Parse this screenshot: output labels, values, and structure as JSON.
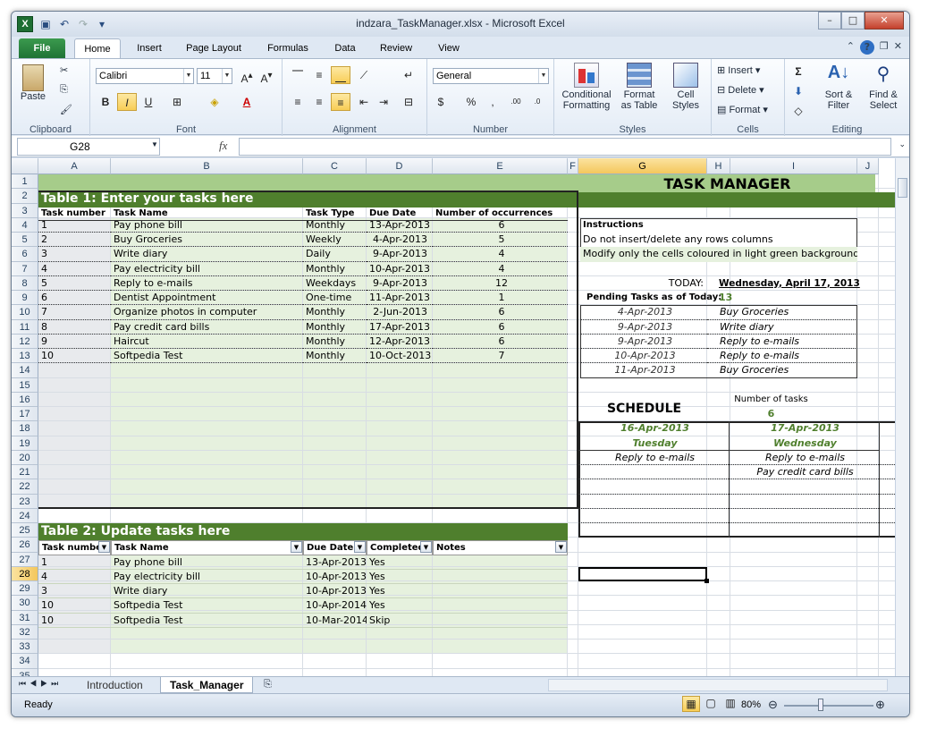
{
  "window": {
    "title": "indzara_TaskManager.xlsx - Microsoft Excel",
    "app_icon": "X"
  },
  "tabs": [
    {
      "label": "File"
    },
    {
      "label": "Home"
    },
    {
      "label": "Insert"
    },
    {
      "label": "Page Layout"
    },
    {
      "label": "Formulas"
    },
    {
      "label": "Data"
    },
    {
      "label": "Review"
    },
    {
      "label": "View"
    }
  ],
  "ribbon": {
    "clipboard": {
      "name": "Clipboard",
      "paste": "Paste"
    },
    "font": {
      "name": "Font",
      "family": "Calibri",
      "size": "11"
    },
    "alignment": {
      "name": "Alignment"
    },
    "number": {
      "name": "Number",
      "format": "General"
    },
    "styles": {
      "name": "Styles",
      "conditional": "Conditional",
      "conditional2": "Formatting",
      "format_table": "Format",
      "format_table2": "as Table",
      "cell_styles": "Cell",
      "cell_styles2": "Styles"
    },
    "cells": {
      "name": "Cells",
      "insert": "Insert",
      "delete": "Delete",
      "format": "Format"
    },
    "editing": {
      "name": "Editing",
      "sort": "Sort &",
      "sort2": "Filter",
      "find": "Find &",
      "find2": "Select"
    }
  },
  "formula_bar": {
    "name_box": "G28",
    "fx": "fx",
    "value": ""
  },
  "columns": [
    "A",
    "B",
    "C",
    "D",
    "E",
    "F",
    "G",
    "H",
    "I",
    "J"
  ],
  "sheet": {
    "title": "TASK MANAGER",
    "table1": {
      "header": "Table 1: Enter your tasks here",
      "columns": [
        "Task number",
        "Task Name",
        "Task Type",
        "Due Date",
        "Number of occurrences"
      ],
      "rows": [
        [
          "1",
          "Pay phone bill",
          "Monthly",
          "13-Apr-2013",
          "6"
        ],
        [
          "2",
          "Buy Groceries",
          "Weekly",
          "4-Apr-2013",
          "5"
        ],
        [
          "3",
          "Write diary",
          "Daily",
          "9-Apr-2013",
          "4"
        ],
        [
          "4",
          "Pay electricity bill",
          "Monthly",
          "10-Apr-2013",
          "4"
        ],
        [
          "5",
          "Reply to e-mails",
          "Weekdays",
          "9-Apr-2013",
          "12"
        ],
        [
          "6",
          "Dentist Appointment",
          "One-time",
          "11-Apr-2013",
          "1"
        ],
        [
          "7",
          "Organize photos in computer",
          "Monthly",
          "2-Jun-2013",
          "6"
        ],
        [
          "8",
          "Pay credit card bills",
          "Monthly",
          "17-Apr-2013",
          "6"
        ],
        [
          "9",
          "Haircut",
          "Monthly",
          "12-Apr-2013",
          "6"
        ],
        [
          "10",
          "Softpedia Test",
          "Monthly",
          "10-Oct-2013",
          "7"
        ]
      ]
    },
    "table2": {
      "header": "Table 2: Update tasks here",
      "columns": [
        "Task numbe",
        "Task Name",
        "Due Date",
        "Completed",
        "Notes"
      ],
      "rows": [
        [
          "1",
          "Pay phone bill",
          "13-Apr-2013",
          "Yes",
          ""
        ],
        [
          "4",
          "Pay electricity bill",
          "10-Apr-2013",
          "Yes",
          ""
        ],
        [
          "3",
          "Write diary",
          "10-Apr-2013",
          "Yes",
          ""
        ],
        [
          "10",
          "Softpedia Test",
          "10-Apr-2014",
          "Yes",
          ""
        ],
        [
          "10",
          "Softpedia Test",
          "10-Mar-2014",
          "Skip",
          ""
        ]
      ]
    },
    "instructions": {
      "title": "Instructions",
      "lines": [
        "Do not insert/delete any rows columns",
        "Modify only the cells coloured in light green background"
      ]
    },
    "today_label": "TODAY:",
    "today_value": "Wednesday, April 17, 2013",
    "pending_label": "Pending Tasks as of Today:",
    "pending_value": "13",
    "pending": [
      [
        "4-Apr-2013",
        "Buy Groceries"
      ],
      [
        "9-Apr-2013",
        "Write diary"
      ],
      [
        "9-Apr-2013",
        "Reply to e-mails"
      ],
      [
        "10-Apr-2013",
        "Reply to e-mails"
      ],
      [
        "11-Apr-2013",
        "Buy Groceries"
      ]
    ],
    "schedule": {
      "title": "SCHEDULE",
      "num_tasks_label": "Number of tasks",
      "num_tasks_value": "6",
      "days": [
        {
          "date": "16-Apr-2013",
          "weekday": "Tuesday",
          "tasks": [
            "Reply to e-mails"
          ]
        },
        {
          "date": "17-Apr-2013",
          "weekday": "Wednesday",
          "tasks": [
            "Reply to e-mails",
            "Pay credit card bills"
          ]
        }
      ]
    }
  },
  "sheet_tabs": [
    {
      "label": "Introduction"
    },
    {
      "label": "Task_Manager"
    }
  ],
  "status": {
    "ready": "Ready",
    "zoom": "80%"
  }
}
